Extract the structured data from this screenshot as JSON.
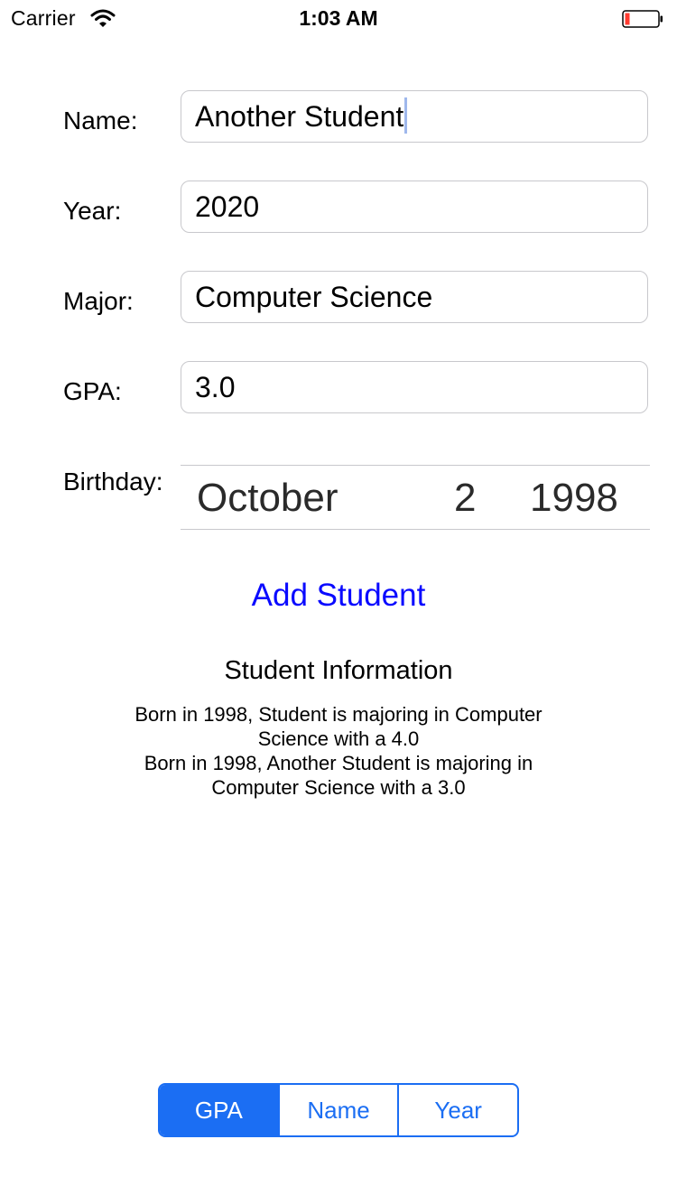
{
  "status_bar": {
    "carrier": "Carrier",
    "time": "1:03 AM",
    "battery_color": "#ff3b30"
  },
  "form": {
    "name_label": "Name:",
    "name_value": "Another Student",
    "year_label": "Year:",
    "year_value": "2020",
    "major_label": "Major:",
    "major_value": "Computer Science",
    "gpa_label": "GPA:",
    "gpa_value": "3.0",
    "birthday_label": "Birthday:",
    "birthday": {
      "month": "October",
      "day": "2",
      "year": "1998"
    }
  },
  "add_button_label": "Add Student",
  "info": {
    "title": "Student Information",
    "entries": [
      "Born in 1998, Student  is majoring in Computer Science with a 4.0",
      "Born in 1998, Another Student is majoring in Computer Science with a 3.0"
    ]
  },
  "sort_control": {
    "segments": [
      "GPA",
      "Name",
      "Year"
    ],
    "selected": "GPA"
  },
  "colors": {
    "accent": "#1b6ef3",
    "button_text": "#0a0aff"
  }
}
